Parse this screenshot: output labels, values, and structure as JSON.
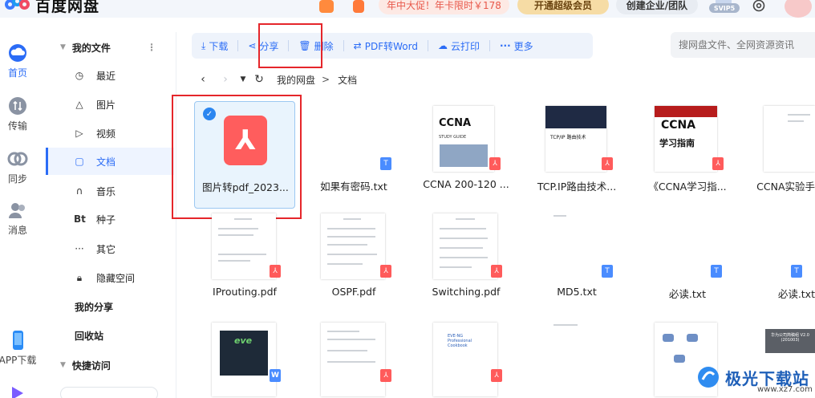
{
  "app": {
    "name": "百度网盘"
  },
  "topbar": {
    "promo": "年中大促！年卡限时￥178",
    "vip_button": "开通超级会员",
    "enterprise_button": "创建企业/团队",
    "svip_badge": "SVIP5"
  },
  "rail": [
    {
      "label": "首页",
      "icon": "cloud-icon"
    },
    {
      "label": "传输",
      "icon": "transfer-icon"
    },
    {
      "label": "同步",
      "icon": "sync-icon"
    },
    {
      "label": "消息",
      "icon": "message-icon"
    },
    {
      "label": "APP下载",
      "icon": "phone-icon"
    }
  ],
  "sidebar": {
    "my_files": "我的文件",
    "items": [
      {
        "label": "最近",
        "icon": "clock-icon"
      },
      {
        "label": "图片",
        "icon": "image-icon"
      },
      {
        "label": "视频",
        "icon": "video-icon"
      },
      {
        "label": "文档",
        "icon": "document-icon",
        "active": true
      },
      {
        "label": "音乐",
        "icon": "headphones-icon"
      },
      {
        "label": "种子",
        "icon": "torrent-icon"
      },
      {
        "label": "其它",
        "icon": "more-icon"
      },
      {
        "label": "隐藏空间",
        "icon": "lock-icon"
      }
    ],
    "my_share": "我的分享",
    "recycle": "回收站",
    "quick_access": "快捷访问"
  },
  "toolbar": {
    "download": "下载",
    "share": "分享",
    "delete": "删除",
    "pdf2word": "PDF转Word",
    "cloud_print": "云打印",
    "more": "更多"
  },
  "search": {
    "placeholder": "搜网盘文件、全网资源资讯"
  },
  "path": {
    "root": "我的网盘",
    "sep": ">",
    "current": "文档"
  },
  "files": [
    {
      "name": "图片转pdf_2023...",
      "type": "pdf"
    },
    {
      "name": "如果有密码.txt",
      "type": "txt"
    },
    {
      "name": "CCNA 200-120 ...",
      "type": "pdf"
    },
    {
      "name": "TCP.IP路由技术...",
      "type": "pdf"
    },
    {
      "name": "《CCNA学习指...",
      "type": "pdf"
    },
    {
      "name": "CCNA实验手",
      "type": "pdf"
    },
    {
      "name": "IProuting.pdf",
      "type": "pdf"
    },
    {
      "name": "OSPF.pdf",
      "type": "pdf"
    },
    {
      "name": "Switching.pdf",
      "type": "pdf"
    },
    {
      "name": "MD5.txt",
      "type": "txt"
    },
    {
      "name": "必读.txt",
      "type": "txt"
    },
    {
      "name": "必读.txt",
      "type": "txt"
    }
  ],
  "covers": {
    "ccna1_title": "CCNA",
    "ccna1_sub": "STUDY GUIDE",
    "tcpip_title": "TCP/IP 路由技术",
    "ccna2_title": "CCNA",
    "ccna2_sub": "学习指南",
    "eve_logo": "eve",
    "eve_guide": "EVE-NG Professional Cookbook",
    "huawei_note": "华为公司简稿组 V2.0 (201003)"
  },
  "watermark": {
    "text": "极光下载站",
    "url": "www.xz7.com"
  }
}
